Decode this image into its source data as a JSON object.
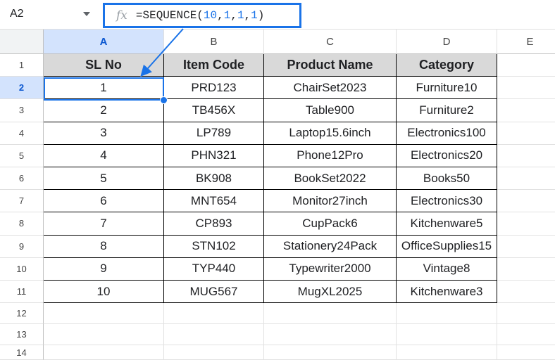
{
  "name_box": "A2",
  "formula_bar": {
    "icon": "fx-icon",
    "prefix": "=SEQUENCE(",
    "args": [
      "10",
      "1",
      "1",
      "1"
    ],
    "suffix": ")"
  },
  "fx_label": "fx",
  "columns": [
    "A",
    "B",
    "C",
    "D",
    "E"
  ],
  "rows": [
    "1",
    "2",
    "3",
    "4",
    "5",
    "6",
    "7",
    "8",
    "9",
    "10",
    "11",
    "12",
    "13",
    "14"
  ],
  "table": {
    "headers": [
      "SL No",
      "Item Code",
      "Product Name",
      "Category"
    ],
    "rows": [
      [
        "1",
        "PRD123",
        "ChairSet2023",
        "Furniture10"
      ],
      [
        "2",
        "TB456X",
        "Table900",
        "Furniture2"
      ],
      [
        "3",
        "LP789",
        "Laptop15.6inch",
        "Electronics100"
      ],
      [
        "4",
        "PHN321",
        "Phone12Pro",
        "Electronics20"
      ],
      [
        "5",
        "BK908",
        "BookSet2022",
        "Books50"
      ],
      [
        "6",
        "MNT654",
        "Monitor27inch",
        "Electronics30"
      ],
      [
        "7",
        "CP893",
        "CupPack6",
        "Kitchenware5"
      ],
      [
        "8",
        "STN102",
        "Stationery24Pack",
        "OfficeSupplies15"
      ],
      [
        "9",
        "TYP440",
        "Typewriter2000",
        "Vintage8"
      ],
      [
        "10",
        "MUG567",
        "MugXL2025",
        "Kitchenware3"
      ]
    ]
  },
  "colors": {
    "accent": "#1a73e8",
    "header_fill": "#d9d9d9",
    "selected_header": "#d3e3fd"
  }
}
